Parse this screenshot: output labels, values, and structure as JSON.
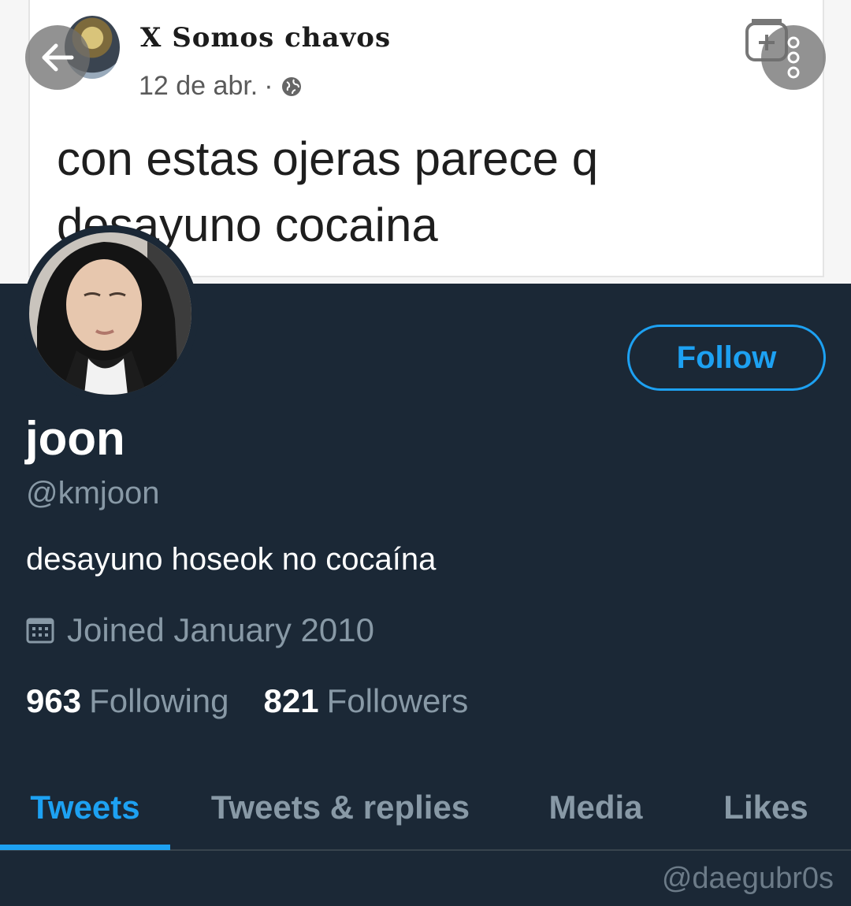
{
  "banner_post": {
    "author": "X Somos chavos",
    "date": "12 de abr.",
    "separator": "·",
    "text": "con estas ojeras parece q desayuno cocaina"
  },
  "icons": {
    "back": "arrow-left-icon",
    "more": "more-vertical-icon",
    "calendar": "calendar-icon",
    "globe": "globe-icon"
  },
  "profile": {
    "display_name": "joon",
    "handle": "@kmjoon",
    "bio": "desayuno hoseok no cocaína",
    "joined": "Joined January 2010",
    "follow_label": "Follow",
    "following_count": "963",
    "following_label": "Following",
    "followers_count": "821",
    "followers_label": "Followers"
  },
  "tabs": [
    {
      "label": "Tweets",
      "active": true
    },
    {
      "label": "Tweets & replies",
      "active": false
    },
    {
      "label": "Media",
      "active": false
    },
    {
      "label": "Likes",
      "active": false
    }
  ],
  "watermark": "@daegubr0s",
  "colors": {
    "background": "#1b2836",
    "accent": "#1da1f2",
    "secondary_text": "#8899a6"
  }
}
